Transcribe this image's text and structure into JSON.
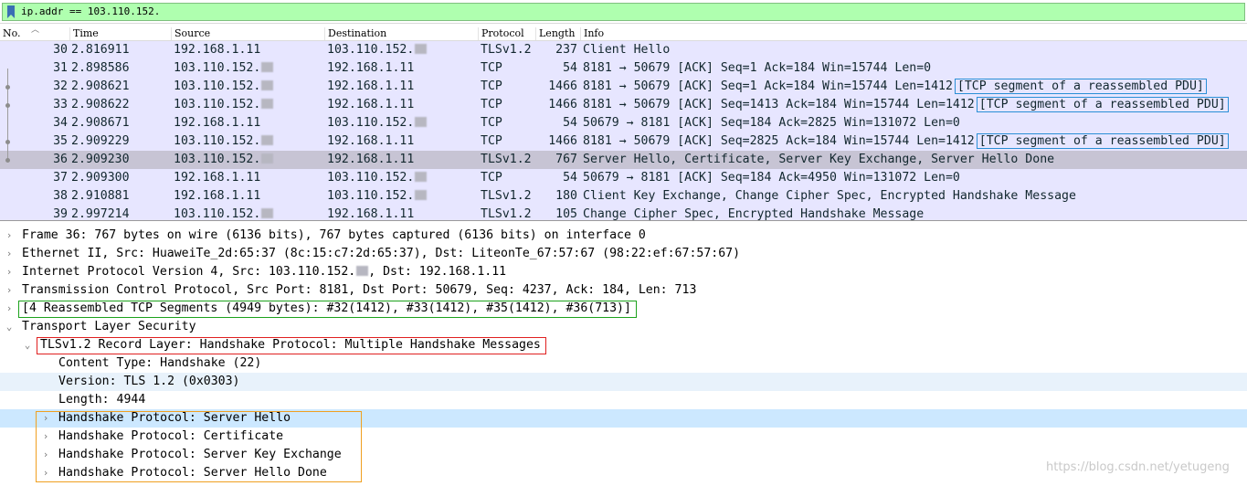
{
  "filter": {
    "value": "ip.addr == 103.110.152."
  },
  "columns": [
    "No.",
    "Time",
    "Source",
    "Destination",
    "Protocol",
    "Length",
    "Info"
  ],
  "packets": [
    {
      "no": "30",
      "time": "2.816911",
      "src": "192.168.1.11",
      "src_masked": false,
      "dst": "103.110.152.",
      "dst_masked": true,
      "proto": "TLSv1.2",
      "len": "237",
      "info": "Client Hello",
      "tag": ""
    },
    {
      "no": "31",
      "time": "2.898586",
      "src": "103.110.152.",
      "src_masked": true,
      "dst": "192.168.1.11",
      "dst_masked": false,
      "proto": "TCP",
      "len": "54",
      "info": "8181 → 50679 [ACK] Seq=1 Ack=184 Win=15744 Len=0",
      "tag": ""
    },
    {
      "no": "32",
      "time": "2.908621",
      "src": "103.110.152.",
      "src_masked": true,
      "dst": "192.168.1.11",
      "dst_masked": false,
      "proto": "TCP",
      "len": "1466",
      "info": "8181 → 50679 [ACK] Seq=1 Ack=184 Win=15744 Len=1412",
      "tag": "[TCP segment of a reassembled PDU]"
    },
    {
      "no": "33",
      "time": "2.908622",
      "src": "103.110.152.",
      "src_masked": true,
      "dst": "192.168.1.11",
      "dst_masked": false,
      "proto": "TCP",
      "len": "1466",
      "info": "8181 → 50679 [ACK] Seq=1413 Ack=184 Win=15744 Len=1412",
      "tag": "[TCP segment of a reassembled PDU]"
    },
    {
      "no": "34",
      "time": "2.908671",
      "src": "192.168.1.11",
      "src_masked": false,
      "dst": "103.110.152.",
      "dst_masked": true,
      "proto": "TCP",
      "len": "54",
      "info": "50679 → 8181 [ACK] Seq=184 Ack=2825 Win=131072 Len=0",
      "tag": ""
    },
    {
      "no": "35",
      "time": "2.909229",
      "src": "103.110.152.",
      "src_masked": true,
      "dst": "192.168.1.11",
      "dst_masked": false,
      "proto": "TCP",
      "len": "1466",
      "info": "8181 → 50679 [ACK] Seq=2825 Ack=184 Win=15744 Len=1412",
      "tag": "[TCP segment of a reassembled PDU]"
    },
    {
      "no": "36",
      "time": "2.909230",
      "src": "103.110.152.",
      "src_masked": true,
      "dst": "192.168.1.11",
      "dst_masked": false,
      "proto": "TLSv1.2",
      "len": "767",
      "info": "Server Hello, Certificate, Server Key Exchange, Server Hello Done",
      "tag": "",
      "selected": true
    },
    {
      "no": "37",
      "time": "2.909300",
      "src": "192.168.1.11",
      "src_masked": false,
      "dst": "103.110.152.",
      "dst_masked": true,
      "proto": "TCP",
      "len": "54",
      "info": "50679 → 8181 [ACK] Seq=184 Ack=4950 Win=131072 Len=0",
      "tag": ""
    },
    {
      "no": "38",
      "time": "2.910881",
      "src": "192.168.1.11",
      "src_masked": false,
      "dst": "103.110.152.",
      "dst_masked": true,
      "proto": "TLSv1.2",
      "len": "180",
      "info": "Client Key Exchange, Change Cipher Spec, Encrypted Handshake Message",
      "tag": ""
    },
    {
      "no": "39",
      "time": "2.997214",
      "src": "103.110.152.",
      "src_masked": true,
      "dst": "192.168.1.11",
      "dst_masked": false,
      "proto": "TLSv1.2",
      "len": "105",
      "info": "Change Cipher Spec, Encrypted Handshake Message",
      "tag": ""
    }
  ],
  "details": [
    {
      "text": "Frame 36: 767 bytes on wire (6136 bits), 767 bytes captured (6136 bits) on interface 0",
      "level": 0,
      "twisty": ">"
    },
    {
      "text": "Ethernet II, Src: HuaweiTe_2d:65:37 (8c:15:c7:2d:65:37), Dst: LiteonTe_67:57:67 (98:22:ef:67:57:67)",
      "level": 0,
      "twisty": ">"
    },
    {
      "text": "Internet Protocol Version 4, Src: 103.110.152.",
      "text_after": ", Dst: 192.168.1.11",
      "level": 0,
      "twisty": ">",
      "masked": true
    },
    {
      "text": "Transmission Control Protocol, Src Port: 8181, Dst Port: 50679, Seq: 4237, Ack: 184, Len: 713",
      "level": 0,
      "twisty": ">"
    },
    {
      "text": "[4 Reassembled TCP Segments (4949 bytes): #32(1412), #33(1412), #35(1412), #36(713)]",
      "level": 0,
      "twisty": ">",
      "box": "green"
    },
    {
      "text": "Transport Layer Security",
      "level": 0,
      "twisty": "v"
    },
    {
      "text": "TLSv1.2 Record Layer: Handshake Protocol: Multiple Handshake Messages",
      "level": 1,
      "twisty": "v",
      "box": "red"
    },
    {
      "text": "Content Type: Handshake (22)",
      "level": 2,
      "twisty": ""
    },
    {
      "text": "Version: TLS 1.2 (0x0303)",
      "level": 2,
      "twisty": "",
      "hl": "light"
    },
    {
      "text": "Length: 4944",
      "level": 2,
      "twisty": ""
    },
    {
      "text": "Handshake Protocol: Server Hello",
      "level": 2,
      "twisty": ">",
      "hl": "strong"
    },
    {
      "text": "Handshake Protocol: Certificate",
      "level": 2,
      "twisty": ">"
    },
    {
      "text": "Handshake Protocol: Server Key Exchange",
      "level": 2,
      "twisty": ">"
    },
    {
      "text": "Handshake Protocol: Server Hello Done",
      "level": 2,
      "twisty": ">"
    }
  ],
  "watermark": "https://blog.csdn.net/yetugeng",
  "colors": {
    "filter_ok": "#afffaf",
    "packet_bg": "#e7e6ff",
    "selected_row": "#c7c4d4",
    "detail_selected": "#cce8ff",
    "box_blue": "#2a8fd6",
    "box_green": "#1ca21c",
    "box_red": "#e02020",
    "box_orange": "#f0a020"
  }
}
